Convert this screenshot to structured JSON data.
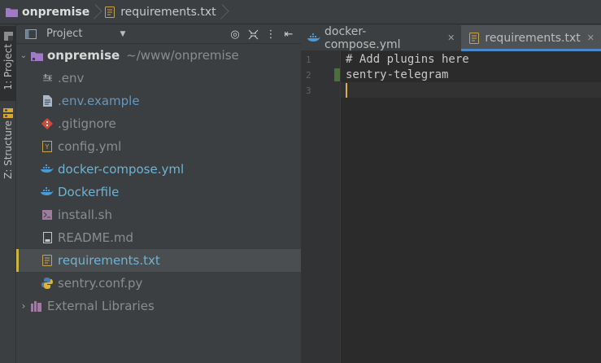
{
  "breadcrumb": {
    "project": "onpremise",
    "file": "requirements.txt"
  },
  "tool_strip": {
    "project_tab": "1: Project",
    "structure_tab": "Z: Structure"
  },
  "project_panel": {
    "title": "Project",
    "tools": [
      "locate-icon",
      "collapse-all-icon",
      "more-icon",
      "hide-icon"
    ],
    "root": {
      "name": "onpremise",
      "path": "~/www/onpremise"
    },
    "files": [
      {
        "name": ".env",
        "icon": "settings-file-icon"
      },
      {
        "name": ".env.example",
        "icon": "text-file-icon"
      },
      {
        "name": ".gitignore",
        "icon": "git-icon"
      },
      {
        "name": "config.yml",
        "icon": "yaml-icon"
      },
      {
        "name": "docker-compose.yml",
        "icon": "docker-icon"
      },
      {
        "name": "Dockerfile",
        "icon": "docker-icon"
      },
      {
        "name": "install.sh",
        "icon": "shell-icon"
      },
      {
        "name": "README.md",
        "icon": "markdown-icon"
      },
      {
        "name": "requirements.txt",
        "icon": "text-file-icon"
      },
      {
        "name": "sentry.conf.py",
        "icon": "python-icon"
      }
    ],
    "external_libraries": "External Libraries"
  },
  "editor": {
    "tabs": [
      {
        "label": "docker-compose.yml",
        "active": false
      },
      {
        "label": "requirements.txt",
        "active": true
      }
    ],
    "line_numbers": [
      "1",
      "2",
      "3"
    ],
    "lines": [
      "# Add plugins here",
      "sentry-telegram",
      ""
    ]
  },
  "colors": {
    "selection_marker": "#c9b43c",
    "caret": "#d9b14a",
    "vcs_added": "#4e6e3b",
    "active_tab_underline": "#4a88c7"
  }
}
